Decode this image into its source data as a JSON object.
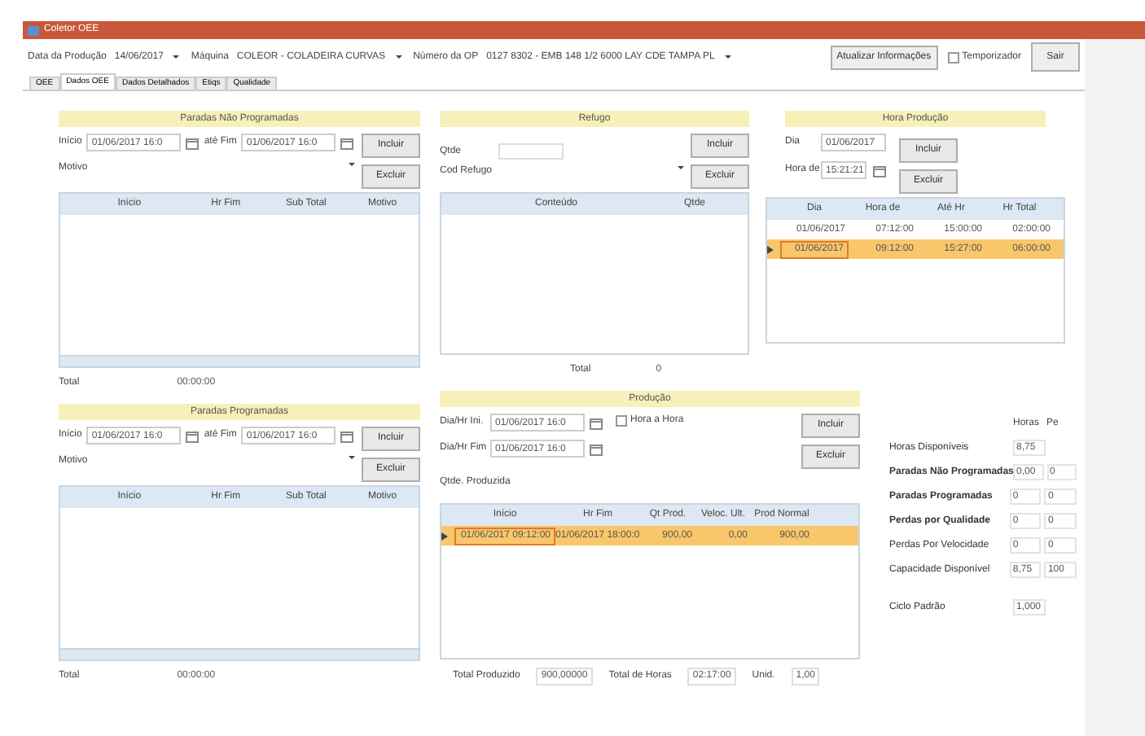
{
  "window": {
    "title": "Coletor OEE"
  },
  "toolbar": {
    "fields": [
      {
        "label": "Data da Produção",
        "value": "14/06/2017"
      },
      {
        "label": "Máquina",
        "value": "COLEOR - COLADEIRA CURVAS"
      },
      {
        "label": "Número da OP",
        "value": "0127 8302 - EMB 148 1/2 6000 LAY CDE TAMPA PL"
      }
    ],
    "refresh_button": "Atualizar Informações",
    "timer": {
      "label": "Temporizador",
      "checked": false
    },
    "exit_button": "Sair"
  },
  "tabs": [
    {
      "label": "OEE",
      "selected": false
    },
    {
      "label": "Dados OEE",
      "selected": true
    },
    {
      "label": "Dados Detalhados",
      "selected": false
    },
    {
      "label": "Etiqs",
      "selected": false
    },
    {
      "label": "Qualidade",
      "selected": false
    }
  ],
  "unplanned": {
    "title": "Paradas Não Programadas",
    "start_label": "Início",
    "start_value": "01/06/2017 16:0",
    "end_label": "até Fim",
    "end_value": "01/06/2017 16:0",
    "reason_label": "Motivo",
    "add_button": "Incluir",
    "delete_button": "Excluir",
    "columns": [
      "Início",
      "Hr Fim",
      "Sub Total",
      "Motivo"
    ],
    "total_label": "Total",
    "total_value": "00:00:00"
  },
  "planned": {
    "title": "Paradas Programadas",
    "start_label": "Início",
    "start_value": "01/06/2017 16:0",
    "end_label": "até Fim",
    "end_value": "01/06/2017 16:0",
    "reason_label": "Motivo",
    "add_button": "Incluir",
    "delete_button": "Excluir",
    "columns": [
      "Início",
      "Hr Fim",
      "Sub Total",
      "Motivo"
    ],
    "total_label": "Total",
    "total_value": "00:00:00"
  },
  "scrap": {
    "title": "Refugo",
    "qty_label": "Qtde",
    "code_label": "Cod Refugo",
    "add_button": "Incluir",
    "delete_button": "Excluir",
    "columns": [
      "Conteúdo",
      "Qtde"
    ],
    "total_label": "Total",
    "total_value": "0"
  },
  "hours": {
    "title": "Hora Produção",
    "day_label": "Dia",
    "day_value": "01/06/2017",
    "time_label": "Hora de",
    "time_value": "15:21:21",
    "add_button": "Incluir",
    "delete_button": "Excluir",
    "columns": [
      "Dia",
      "Hora de",
      "Até Hr",
      "Hr Total"
    ],
    "rows": [
      {
        "cells": [
          "01/06/2017",
          "07:12:00",
          "15:00:00",
          "02:00:00"
        ],
        "selected": false
      },
      {
        "cells": [
          "01/06/2017",
          "09:12:00",
          "15:27:00",
          "06:00:00"
        ],
        "selected": true
      }
    ]
  },
  "production": {
    "title": "Produção",
    "start_label": "Dia/Hr Ini.",
    "start_value": "01/06/2017 16:0",
    "end_label": "Dia/Hr Fim",
    "end_value": "01/06/2017 16:0",
    "hourly": {
      "label": "Hora a Hora",
      "checked": false
    },
    "add_button": "Incluir",
    "delete_button": "Excluir",
    "qty_label": "Qtde. Produzida",
    "columns": [
      "Início",
      "Hr Fim",
      "Qt Prod.",
      "Veloc. Ult.",
      "Prod Normal"
    ],
    "rows": [
      {
        "cells": [
          "01/06/2017 09:12:00",
          "01/06/2017 18:00:0",
          "900,00",
          "0,00",
          "900,00"
        ],
        "selected": true
      }
    ],
    "footer": [
      {
        "label": "Total Produzido",
        "value": "900,00000"
      },
      {
        "label": "Total de Horas",
        "value": "02:17:00"
      },
      {
        "label": "Unid.",
        "value": "1,00"
      }
    ]
  },
  "summary": {
    "columns": [
      "Horas",
      "Pe"
    ],
    "rows": [
      {
        "label": "Horas Disponíveis",
        "bold": false,
        "values": [
          "8,75"
        ]
      },
      {
        "label": "Paradas Não Programadas",
        "bold": true,
        "values": [
          "0,00",
          "0"
        ]
      },
      {
        "label": "Paradas Programadas",
        "bold": true,
        "values": [
          "0",
          "0"
        ]
      },
      {
        "label": "Perdas por Qualidade",
        "bold": true,
        "values": [
          "0",
          "0"
        ]
      },
      {
        "label": "Perdas Por Velocidade",
        "bold": false,
        "values": [
          "0",
          "0"
        ]
      },
      {
        "label": "Capacidade Disponível",
        "bold": false,
        "values": [
          "8,75",
          "100"
        ]
      }
    ],
    "cycle": {
      "label": "Ciclo Padrão",
      "value": "1,000"
    }
  }
}
